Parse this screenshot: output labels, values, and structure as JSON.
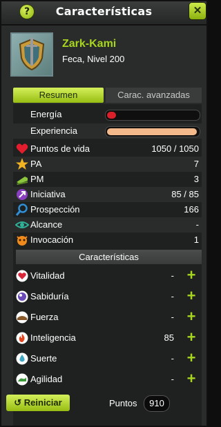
{
  "window": {
    "title": "Características",
    "help_label": "?",
    "close_label": "✕"
  },
  "character": {
    "name": "Zark-Kami",
    "subtitle": "Feca, Nivel 200"
  },
  "tabs": [
    {
      "label": "Resumen",
      "active": true
    },
    {
      "label": "Carac. avanzadas",
      "active": false
    }
  ],
  "bars": [
    {
      "label": "Energía",
      "fraction": 0.1,
      "color": "#d81f2a"
    },
    {
      "label": "Experiencia",
      "fraction": 1.0,
      "color": "#f3b98a"
    }
  ],
  "stats": [
    {
      "icon": "heart-icon",
      "label": "Puntos de vida",
      "value": "1050 / 1050"
    },
    {
      "icon": "star-icon",
      "label": "PA",
      "value": "7"
    },
    {
      "icon": "boot-icon",
      "label": "PM",
      "value": "3"
    },
    {
      "icon": "initiative-icon",
      "label": "Iniciativa",
      "value": "85 / 85"
    },
    {
      "icon": "magnifier-icon",
      "label": "Prospección",
      "value": "166"
    },
    {
      "icon": "eye-icon",
      "label": "Alcance",
      "value": "-"
    },
    {
      "icon": "invocation-icon",
      "label": "Invocación",
      "value": "1"
    }
  ],
  "characteristics_header": "Características",
  "characteristics": [
    {
      "icon": "vitality-icon",
      "label": "Vitalidad",
      "value": "-",
      "color": "#d8263a"
    },
    {
      "icon": "wisdom-icon",
      "label": "Sabiduría",
      "value": "-",
      "color": "#6b4bb8"
    },
    {
      "icon": "strength-icon",
      "label": "Fuerza",
      "value": "-",
      "color": "#8b5a2b"
    },
    {
      "icon": "intelligence-icon",
      "label": "Inteligencia",
      "value": "85",
      "color": "#e2451f"
    },
    {
      "icon": "chance-icon",
      "label": "Suerte",
      "value": "-",
      "color": "#3fa7c4"
    },
    {
      "icon": "agility-icon",
      "label": "Agilidad",
      "value": "-",
      "color": "#3c9a3c"
    }
  ],
  "footer": {
    "reset_label": "Reiniciar",
    "points_label": "Puntos",
    "points_value": "910"
  },
  "colors": {
    "accent": "#a7d61e",
    "panel": "#2a2b2b"
  }
}
